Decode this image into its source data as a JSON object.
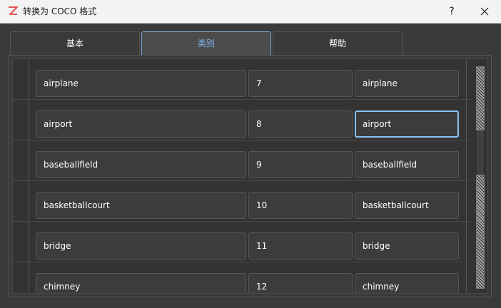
{
  "window": {
    "title": "转换为 COCO 格式",
    "help_label": "?",
    "icon": "z-logo-icon",
    "accent_color": "#e0564b"
  },
  "tabs": [
    {
      "label": "基本",
      "selected": false
    },
    {
      "label": "类别",
      "selected": true
    },
    {
      "label": "帮助",
      "selected": false
    }
  ],
  "categories": [
    {
      "name": "airplane",
      "id": "7",
      "label": "airplane"
    },
    {
      "name": "airport",
      "id": "8",
      "label": "airport"
    },
    {
      "name": "baseballfield",
      "id": "9",
      "label": "baseballfield"
    },
    {
      "name": "basketballcourt",
      "id": "10",
      "label": "basketballcourt"
    },
    {
      "name": "bridge",
      "id": "11",
      "label": "bridge"
    },
    {
      "name": "chimney",
      "id": "12",
      "label": "chimney"
    }
  ],
  "colors": {
    "focus_border": "#8cc0f0",
    "selected_tab_text": "#7fb6ea"
  }
}
